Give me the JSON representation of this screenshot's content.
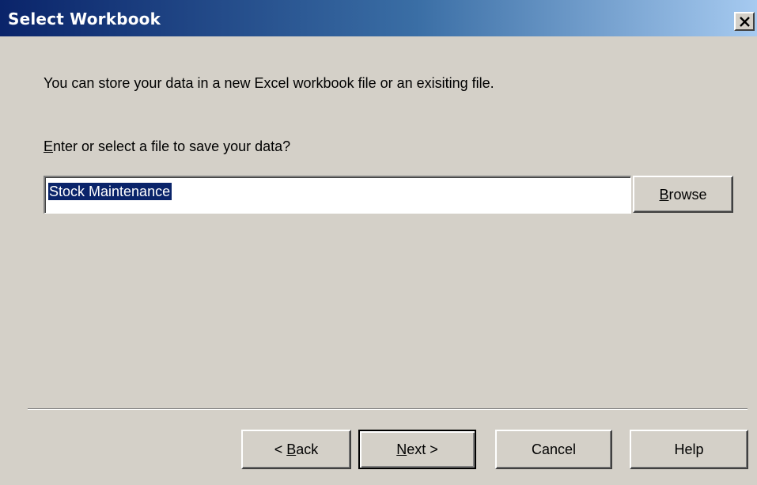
{
  "window": {
    "title": "Select Workbook",
    "close_label": "×"
  },
  "content": {
    "intro_text": "You can store your data in a new Excel workbook file or an exisiting file.",
    "prompt": {
      "mnemonic": "E",
      "rest": "nter or select a file to save your data?"
    },
    "file_value": "Stock Maintenance"
  },
  "buttons": {
    "browse": {
      "mnemonic": "B",
      "rest": "rowse"
    },
    "back": {
      "prefix": "< ",
      "mnemonic": "B",
      "rest": "ack"
    },
    "next": {
      "mnemonic": "N",
      "rest": "ext >"
    },
    "cancel": "Cancel",
    "help": "Help"
  },
  "icons": {
    "close": "close-icon"
  }
}
